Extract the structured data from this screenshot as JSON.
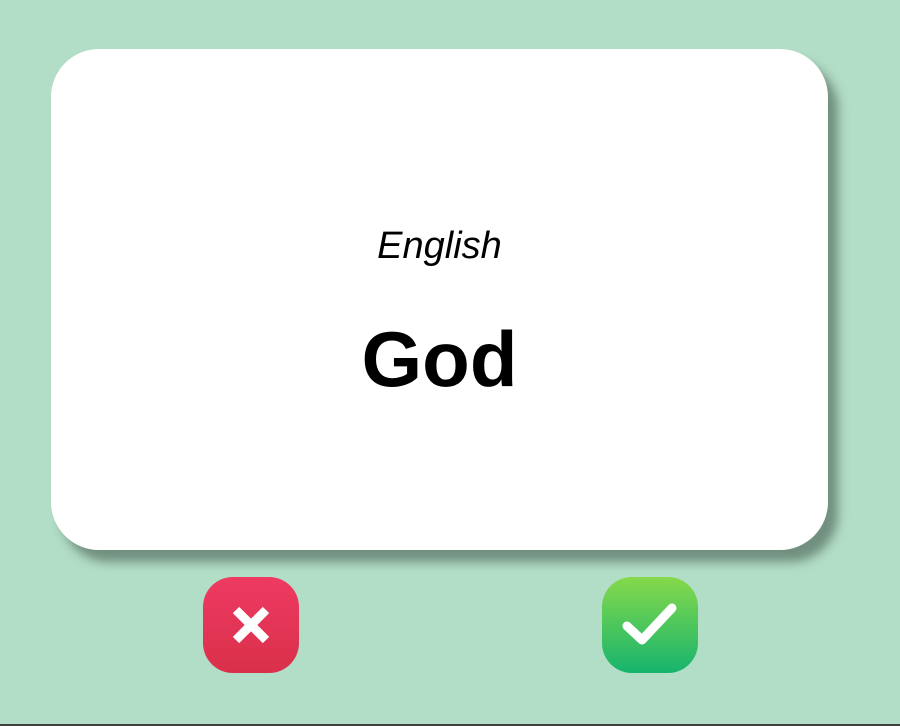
{
  "card": {
    "language": "English",
    "word": "God"
  },
  "buttons": {
    "wrong": {
      "icon": "close-icon",
      "color": "#e8375a"
    },
    "right": {
      "icon": "check-icon",
      "color": "#2fbf5c"
    }
  },
  "colors": {
    "background": "#b2ddc6",
    "card": "#ffffff"
  }
}
